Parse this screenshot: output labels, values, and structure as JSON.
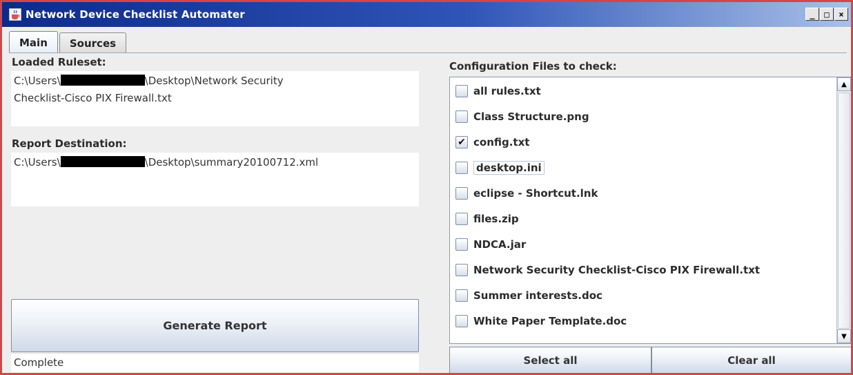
{
  "window": {
    "title": "Network Device Checklist Automater",
    "controls": {
      "minimize": "_",
      "maximize": "□",
      "close": "×"
    }
  },
  "tabs": [
    {
      "label": "Main",
      "active": true
    },
    {
      "label": "Sources",
      "active": false
    }
  ],
  "ruleset": {
    "label": "Loaded Ruleset:",
    "line1_prefix": "C:\\Users\\",
    "line1_suffix": "\\Desktop\\Network Security",
    "line2": "Checklist-Cisco PIX Firewall.txt"
  },
  "report": {
    "label": "Report Destination:",
    "prefix": "C:\\Users\\",
    "suffix": "\\Desktop\\summary20100712.xml"
  },
  "generate_button": "Generate Report",
  "status_text": "Complete",
  "config": {
    "label": "Configuration Files to check:",
    "files": [
      {
        "name": "all rules.txt",
        "checked": false
      },
      {
        "name": "Class Structure.png",
        "checked": false
      },
      {
        "name": "config.txt",
        "checked": true
      },
      {
        "name": "desktop.ini",
        "checked": false,
        "focused": true
      },
      {
        "name": "eclipse - Shortcut.lnk",
        "checked": false
      },
      {
        "name": "files.zip",
        "checked": false
      },
      {
        "name": "NDCA.jar",
        "checked": false
      },
      {
        "name": "Network Security Checklist-Cisco PIX Firewall.txt",
        "checked": false
      },
      {
        "name": "Summer interests.doc",
        "checked": false
      },
      {
        "name": "White Paper Template.doc",
        "checked": false
      }
    ],
    "select_all": "Select all",
    "clear_all": "Clear all"
  },
  "icons": {
    "app": "java-cup-icon",
    "check": "checkmark-icon",
    "scroll_up": "triangle-up-icon",
    "scroll_down": "triangle-down-icon"
  }
}
